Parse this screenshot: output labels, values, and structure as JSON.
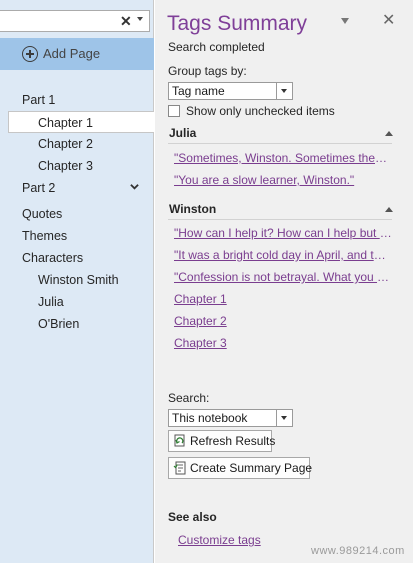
{
  "nav": {
    "add_page_label": "Add Page",
    "pages": [
      {
        "label": "Part 1",
        "level": 0
      },
      {
        "label": "Chapter 1",
        "level": 1,
        "selected": true
      },
      {
        "label": "Chapter 2",
        "level": 1
      },
      {
        "label": "Chapter 3",
        "level": 1
      },
      {
        "label": "Part 2",
        "level": 0,
        "collapsible": true
      },
      {
        "label": "Quotes",
        "level": 0
      },
      {
        "label": "Themes",
        "level": 0
      },
      {
        "label": "Characters",
        "level": 0
      },
      {
        "label": "Winston Smith",
        "level": 1
      },
      {
        "label": "Julia",
        "level": 1
      },
      {
        "label": "O'Brien",
        "level": 1
      }
    ]
  },
  "pane": {
    "title": "Tags Summary",
    "status": "Search completed",
    "group_label": "Group tags by:",
    "group_value": "Tag name",
    "unchecked_label": "Show only unchecked items",
    "groups": [
      {
        "name": "Julia",
        "items": [
          "\"Sometimes, Winston. Sometimes they are five. Sometimes they are three.\"",
          "\"You are a slow learner, Winston.\""
        ]
      },
      {
        "name": "Winston",
        "items": [
          "\"How can I help it? How can I help but see what is in front of my eyes?\"",
          "\"It was a bright cold day in April, and the clocks were striking thirteen.\"",
          "\"Confession is not betrayal. What you say or do doesn't matter.\"",
          "Chapter 1",
          "Chapter 2",
          "Chapter 3"
        ]
      }
    ],
    "search_label": "Search:",
    "search_value": "This notebook",
    "refresh_label": "Refresh Results",
    "create_label": "Create Summary Page",
    "see_also": "See also",
    "customize": "Customize tags",
    "watermark": "www.989214.com"
  },
  "colors": {
    "title": "#7f3f98",
    "link": "#7a3d8f",
    "nav_bg": "#dde9f5",
    "add_page_bg": "#9ec4e8",
    "pane_bg": "#f0f0f0"
  },
  "icons": {
    "search_clear": "close-icon",
    "search_dropdown": "chevron-down-icon",
    "add_page": "plus-circle-icon",
    "part_toggle": "chevron-down-icon",
    "pane_menu": "caret-down-icon",
    "pane_close": "close-icon",
    "collapse": "caret-up-icon",
    "refresh": "refresh-icon",
    "summary": "summary-page-icon"
  }
}
